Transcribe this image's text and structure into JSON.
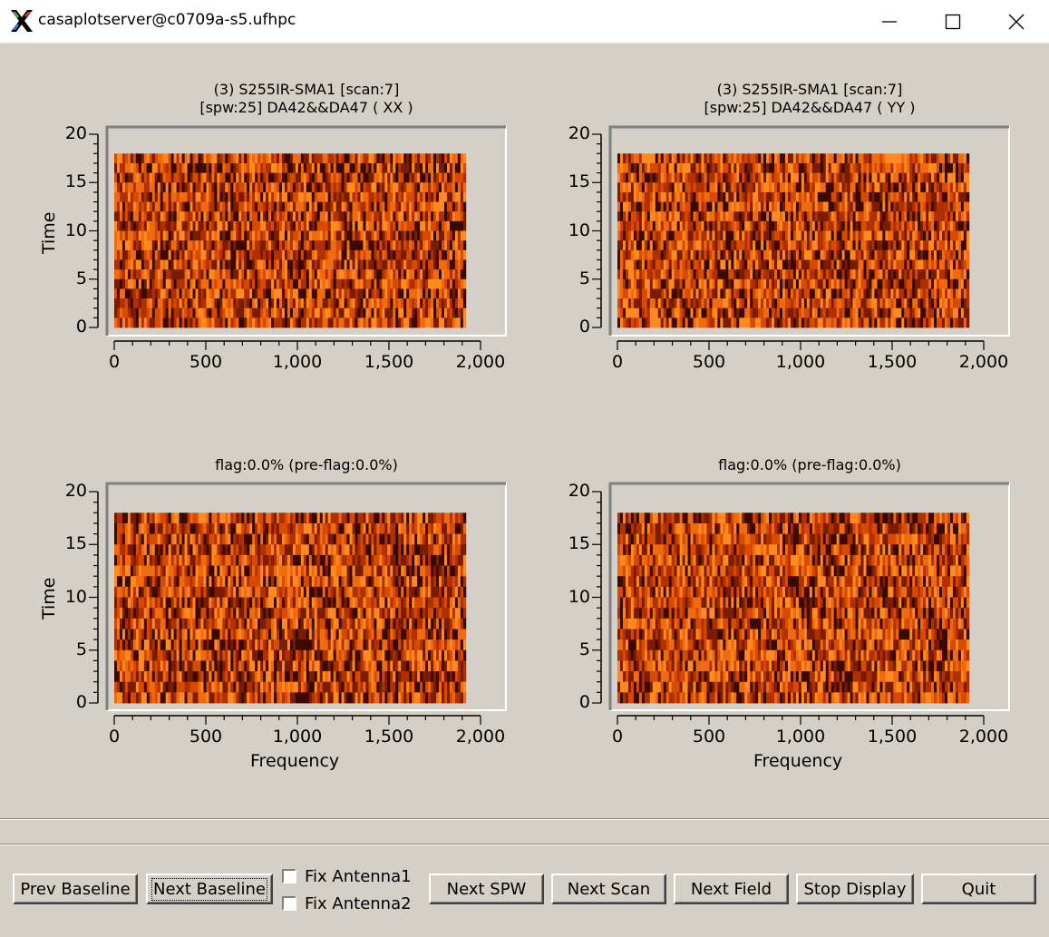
{
  "window": {
    "title": "casaplotserver@c0709a-s5.ufhpc"
  },
  "plots": [
    {
      "title1": "(3) S255IR-SMA1  [scan:7]",
      "title2": "[spw:25] DA42&&DA47  ( XX )"
    },
    {
      "title1": "(3) S255IR-SMA1  [scan:7]",
      "title2": "[spw:25] DA42&&DA47  ( YY )"
    },
    {
      "title1": "flag:0.0% (pre-flag:0.0%)",
      "title2": ""
    },
    {
      "title1": "flag:0.0% (pre-flag:0.0%)",
      "title2": ""
    }
  ],
  "axes": {
    "ylabel": "Time",
    "xlabel": "Frequency",
    "yticks": [
      "20",
      "15",
      "10",
      "5",
      "0"
    ],
    "xticks": [
      "0",
      "500",
      "1,000",
      "1,500",
      "2,000"
    ]
  },
  "chart_data": {
    "type": "heatmap",
    "x_range": [
      0,
      2000
    ],
    "y_range": [
      0,
      20
    ],
    "data_extent_x": [
      0,
      1920
    ],
    "data_extent_y": [
      0,
      18
    ],
    "colormap_colors": [
      "#3a0a00",
      "#7a1c00",
      "#b03000",
      "#d84a00",
      "#f06a10",
      "#ff8a20"
    ]
  },
  "buttons": {
    "prev_baseline": "Prev Baseline",
    "next_baseline": "Next Baseline",
    "fix_antenna1": "Fix Antenna1",
    "fix_antenna2": "Fix Antenna2",
    "next_spw": "Next SPW",
    "next_scan": "Next Scan",
    "next_field": "Next Field",
    "stop_display": "Stop Display",
    "quit": "Quit"
  }
}
